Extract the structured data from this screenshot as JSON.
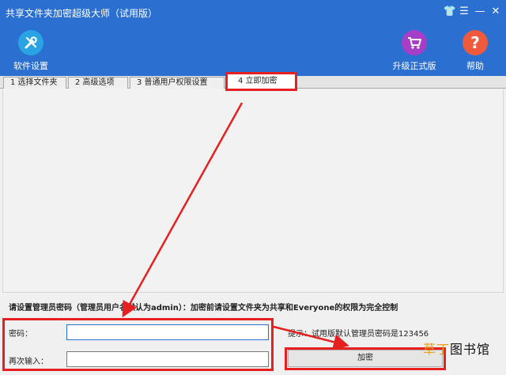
{
  "window": {
    "title": "共享文件夹加密超级大师（试用版）",
    "controls": {
      "skin": "👕",
      "menu": "☰",
      "minimize": "—",
      "close": "✕"
    },
    "accent_color": "#2b6fd1"
  },
  "toolbar": {
    "settings_label": "软件设置",
    "upgrade_label": "升级正式版",
    "help_label": "帮助",
    "help_glyph": "?",
    "settings_color": "#29a3e4",
    "upgrade_color": "#a73ec8",
    "help_color": "#f05a3c"
  },
  "tabs": [
    {
      "label": "1 选择文件夹"
    },
    {
      "label": "2 高级选项"
    },
    {
      "label": "3 普通用户权限设置"
    },
    {
      "label": "4 立即加密"
    }
  ],
  "form": {
    "notice": "请设置管理员密码（管理员用户名默认为admin）：加密前请设置文件夹为共享和Everyone的权限为完全控制",
    "password_label": "密码：",
    "password_value": "",
    "confirm_label": "再次输入：",
    "confirm_value": "",
    "hint": "提示：试用版默认管理员密码是123456",
    "encrypt_button": "加密"
  },
  "watermark": {
    "accent": "草丁",
    "rest": "图书馆"
  },
  "annotation_color": "#e62020"
}
